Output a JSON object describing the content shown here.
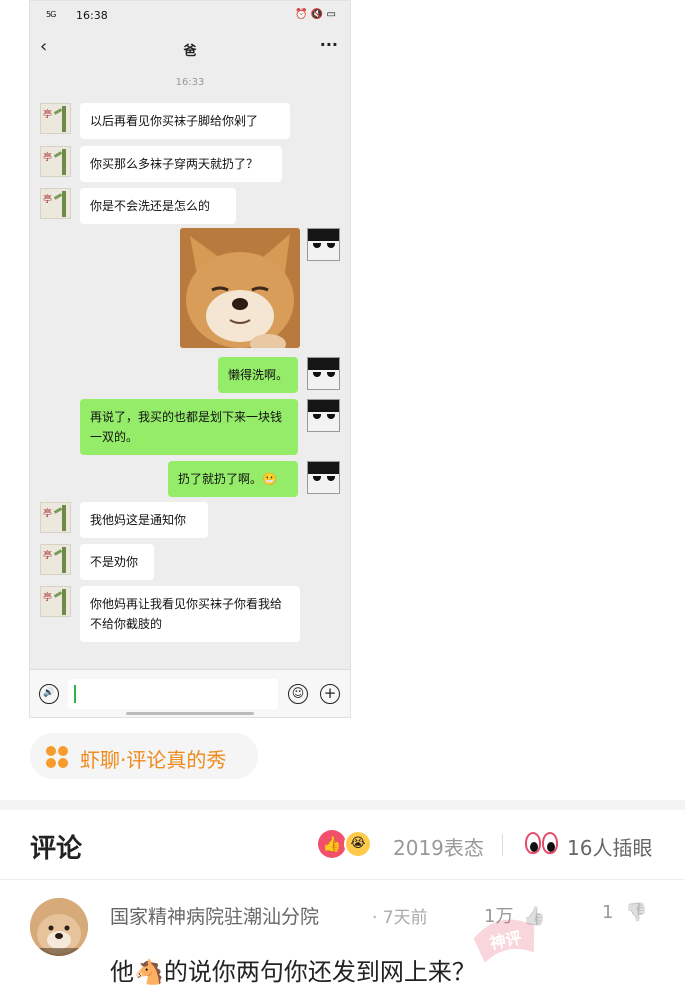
{
  "phone": {
    "status_bar": {
      "signal": "5G",
      "time": "16:38",
      "right_icons": "⏰ 🔇 ▭"
    },
    "nav": {
      "back": "‹",
      "title": "爸",
      "more": "···"
    },
    "timestamp": "16:33",
    "messages": [
      {
        "side": "left",
        "text": "以后再看见你买袜子脚给你剁了"
      },
      {
        "side": "left",
        "text": "你买那么多袜子穿两天就扔了？"
      },
      {
        "side": "left",
        "text": "你是不会洗还是怎么的"
      },
      {
        "side": "right",
        "type": "image",
        "image_desc": "shiba-dog-sticker"
      },
      {
        "side": "right",
        "text": "懒得洗啊。"
      },
      {
        "side": "right",
        "text": "再说了，我买的也都是划下来一块钱一双的。"
      },
      {
        "side": "right",
        "text": "扔了就扔了啊。😬"
      },
      {
        "side": "left",
        "text": "我他妈这是通知你"
      },
      {
        "side": "left",
        "text": "不是劝你"
      },
      {
        "side": "left",
        "text": "你他妈再让我看见你买袜子你看我给不给你截肢的"
      }
    ],
    "input_bar": {
      "voice_icon": "🔊",
      "emoji_icon": "☺",
      "plus_icon": "+"
    }
  },
  "topic": {
    "label": "虾聊·评论真的秀"
  },
  "comments_header": {
    "title": "评论",
    "reactions_count": "2019表态",
    "eyes_count": "16人插眼",
    "like_glyph": "👍",
    "cry_glyph": "😭"
  },
  "comment": {
    "username": "国家精神病院驻潮汕分院",
    "time": "· 7天前",
    "likes": "1万",
    "dislikes": "1",
    "text_before": "他",
    "text_after": "的说你两句你还发到网上来？",
    "emoji": "🐴",
    "thumb_up_icon": "👍",
    "thumb_down_icon": "👎",
    "watermark": "神评"
  },
  "colors": {
    "accent": "#ef8a1c",
    "bubble_right": "#95ec69",
    "like_red": "#f2506a"
  }
}
